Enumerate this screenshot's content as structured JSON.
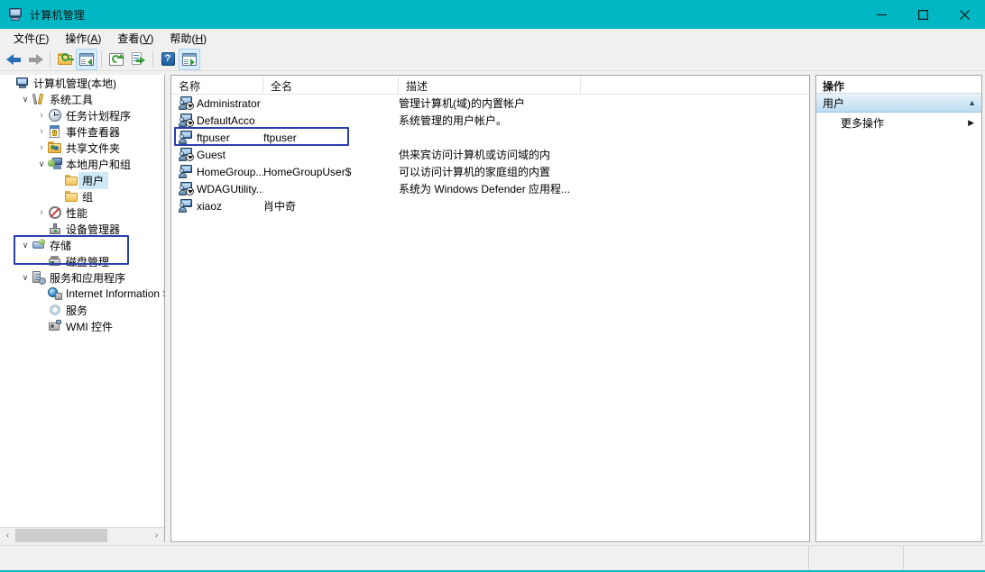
{
  "window": {
    "title": "计算机管理",
    "icon": "computer-management-icon",
    "minimize_label": "最小化",
    "maximize_label": "最大化",
    "close_label": "关闭",
    "titlebar_color": "#00b7c3"
  },
  "menubar": {
    "items": [
      {
        "label": "文件",
        "accel": "F"
      },
      {
        "label": "操作",
        "accel": "A"
      },
      {
        "label": "查看",
        "accel": "V"
      },
      {
        "label": "帮助",
        "accel": "H"
      }
    ]
  },
  "toolbar": {
    "buttons": [
      {
        "name": "back-button",
        "icon": "back-arrow-icon",
        "enabled": true
      },
      {
        "name": "forward-button",
        "icon": "forward-arrow-icon",
        "enabled": false
      },
      {
        "name": "up-folder-button",
        "icon": "folder-key-icon",
        "enabled": true
      },
      {
        "name": "show-hide-tree-button",
        "icon": "console-tree-icon",
        "enabled": true
      },
      {
        "name": "refresh-button",
        "icon": "refresh-icon",
        "enabled": true
      },
      {
        "name": "export-list-button",
        "icon": "export-list-icon",
        "enabled": true
      },
      {
        "name": "help-button",
        "icon": "help-question-icon",
        "enabled": true
      },
      {
        "name": "show-action-pane-button",
        "icon": "action-pane-icon",
        "enabled": true
      }
    ]
  },
  "tree": {
    "nodes": [
      {
        "label": "计算机管理(本地)",
        "icon": "computer-icon",
        "depth": 0,
        "chevron": "none",
        "selected": false
      },
      {
        "label": "系统工具",
        "icon": "tools-icon",
        "depth": 1,
        "chevron": "expanded",
        "selected": false
      },
      {
        "label": "任务计划程序",
        "icon": "clock-icon",
        "depth": 2,
        "chevron": "collapsed",
        "selected": false
      },
      {
        "label": "事件查看器",
        "icon": "event-log-icon",
        "depth": 2,
        "chevron": "collapsed",
        "selected": false
      },
      {
        "label": "共享文件夹",
        "icon": "shared-folder-icon",
        "depth": 2,
        "chevron": "collapsed",
        "selected": false
      },
      {
        "label": "本地用户和组",
        "icon": "local-users-icon",
        "depth": 2,
        "chevron": "expanded",
        "selected": false
      },
      {
        "label": "用户",
        "icon": "folder-icon",
        "depth": 3,
        "chevron": "none",
        "selected": true
      },
      {
        "label": "组",
        "icon": "folder-icon",
        "depth": 3,
        "chevron": "none",
        "selected": false
      },
      {
        "label": "性能",
        "icon": "performance-icon",
        "depth": 2,
        "chevron": "collapsed",
        "selected": false
      },
      {
        "label": "设备管理器",
        "icon": "device-manager-icon",
        "depth": 2,
        "chevron": "none",
        "selected": false
      },
      {
        "label": "存储",
        "icon": "storage-icon",
        "depth": 1,
        "chevron": "expanded",
        "selected": false
      },
      {
        "label": "磁盘管理",
        "icon": "disk-management-icon",
        "depth": 2,
        "chevron": "none",
        "selected": false
      },
      {
        "label": "服务和应用程序",
        "icon": "services-apps-icon",
        "depth": 1,
        "chevron": "expanded",
        "selected": false
      },
      {
        "label": "Internet Information Ser",
        "icon": "iis-icon",
        "depth": 2,
        "chevron": "none",
        "selected": false
      },
      {
        "label": "服务",
        "icon": "gear-icon",
        "depth": 2,
        "chevron": "none",
        "selected": false
      },
      {
        "label": "WMI 控件",
        "icon": "wmi-icon",
        "depth": 2,
        "chevron": "none",
        "selected": false
      }
    ],
    "annotation_color": "#2a3fb0",
    "scrollbar": {
      "left_arrow": "‹",
      "right_arrow": "›"
    }
  },
  "list": {
    "columns": [
      {
        "key": "name",
        "label": "名称"
      },
      {
        "key": "full",
        "label": "全名"
      },
      {
        "key": "desc",
        "label": "描述"
      }
    ],
    "rows": [
      {
        "name": "Administrator",
        "full": "",
        "desc": "管理计算机(域)的内置帐户",
        "icon": "user-disabled-icon",
        "highlighted": false
      },
      {
        "name": "DefaultAcco",
        "full": "",
        "desc": "系统管理的用户帐户。",
        "icon": "user-disabled-icon",
        "highlighted": false
      },
      {
        "name": "ftpuser",
        "full": "ftpuser",
        "desc": "",
        "icon": "user-icon",
        "highlighted": true
      },
      {
        "name": "Guest",
        "full": "",
        "desc": "供来宾访问计算机或访问域的内",
        "icon": "user-disabled-icon",
        "highlighted": false
      },
      {
        "name": "HomeGroup...",
        "full": "HomeGroupUser$",
        "desc": "可以访问计算机的家庭组的内置",
        "icon": "user-icon",
        "highlighted": false
      },
      {
        "name": "WDAGUtility...",
        "full": "",
        "desc": "系统为 Windows Defender 应用程...",
        "icon": "user-disabled-icon",
        "highlighted": false
      },
      {
        "name": "xiaoz",
        "full": "肖中奇",
        "desc": "",
        "icon": "user-icon",
        "highlighted": false
      }
    ],
    "annotation_color": "#2a3fb0"
  },
  "actions": {
    "title": "操作",
    "group_label": "用户",
    "group_caret": "▲",
    "items": [
      {
        "label": "更多操作",
        "caret": "▶"
      }
    ]
  },
  "statusbar": {
    "left": "",
    "middle": "",
    "right": ""
  }
}
